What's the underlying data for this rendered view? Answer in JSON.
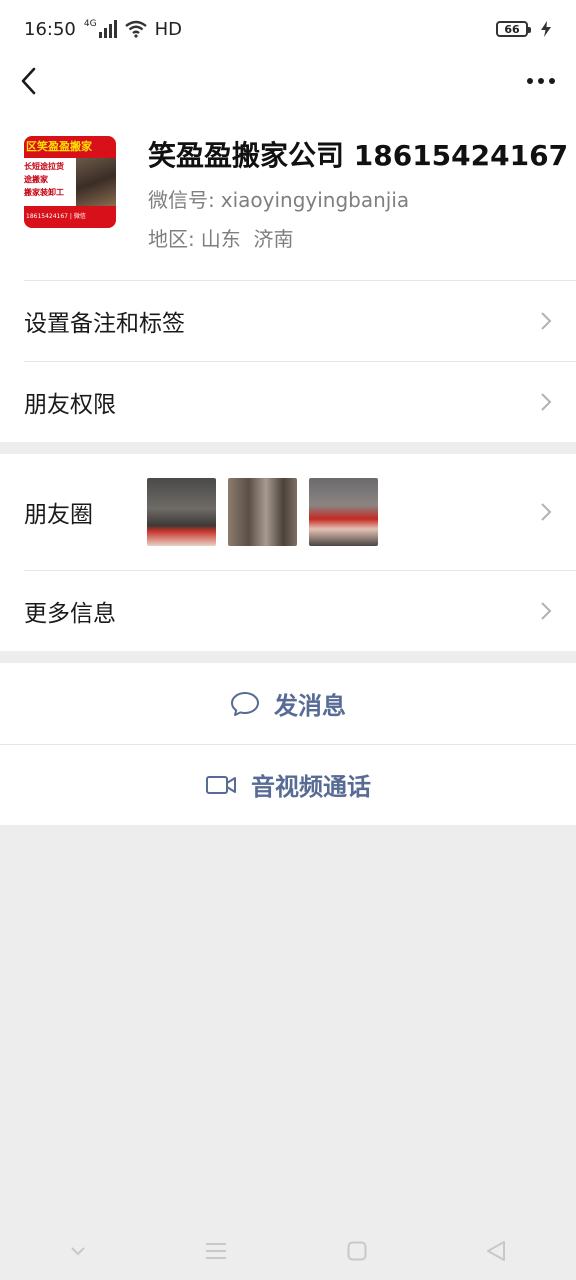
{
  "status": {
    "time": "16:50",
    "network": "4G",
    "hd": "HD",
    "battery": "66"
  },
  "nav": {
    "back_icon": "chevron-left-icon",
    "more_icon": "more-dots-icon"
  },
  "profile": {
    "name": "笑盈盈搬家公司 18615424167",
    "wechat_label": "微信号:",
    "wechat_id": "xiaoyingyingbanjia",
    "region_label": "地区:",
    "region": "山东  济南",
    "avatar_text": {
      "line1": "区笑盈盈搬家",
      "line2": "长短途拉货",
      "line3": "途搬家",
      "line4": "搬家装卸工",
      "line5": "18615424167 | 微信"
    }
  },
  "rows": {
    "remark": "设置备注和标签",
    "permission": "朋友权限",
    "moments": "朋友圈",
    "more_info": "更多信息"
  },
  "actions": {
    "message": "发消息",
    "call": "音视频通话"
  },
  "colors": {
    "accent": "#576b95",
    "background": "#ededed"
  }
}
